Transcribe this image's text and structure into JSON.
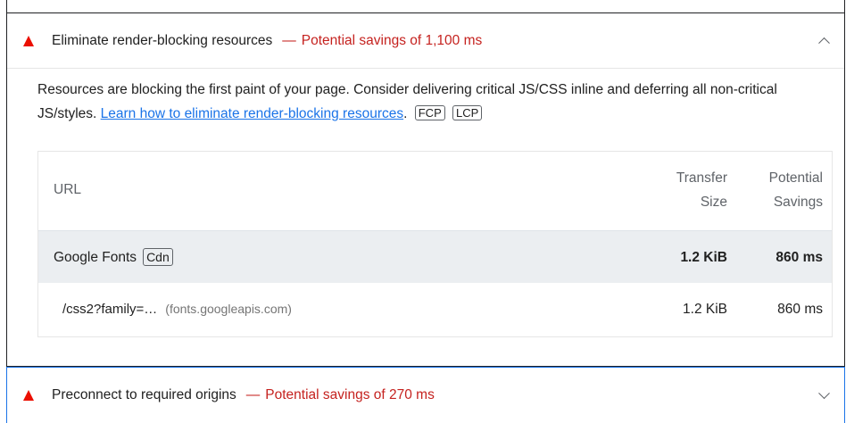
{
  "audit_expanded": {
    "title": "Eliminate render-blocking resources",
    "separator": "—",
    "savings": "Potential savings of 1,100 ms",
    "description_prefix": "Resources are blocking the first paint of your page. Consider delivering critical JS/CSS inline and deferring all non-critical JS/styles. ",
    "learn_link": "Learn how to eliminate render-blocking resources",
    "description_suffix": ".",
    "metrics": [
      "FCP",
      "LCP"
    ],
    "table": {
      "headers": {
        "url": "URL",
        "size": "Transfer Size",
        "savings": "Potential Savings"
      },
      "group": {
        "name": "Google Fonts",
        "badge": "Cdn",
        "size": "1.2 KiB",
        "savings": "860 ms"
      },
      "rows": [
        {
          "url": "/css2?family=…",
          "host": "(fonts.googleapis.com)",
          "size": "1.2 KiB",
          "savings": "860 ms"
        }
      ]
    }
  },
  "audit_collapsed": {
    "title": "Preconnect to required origins",
    "separator": "—",
    "savings": "Potential savings of 270 ms"
  },
  "colors": {
    "fail": "#eb0f00",
    "savings_text": "#c5221f",
    "link": "#1a73e8"
  }
}
